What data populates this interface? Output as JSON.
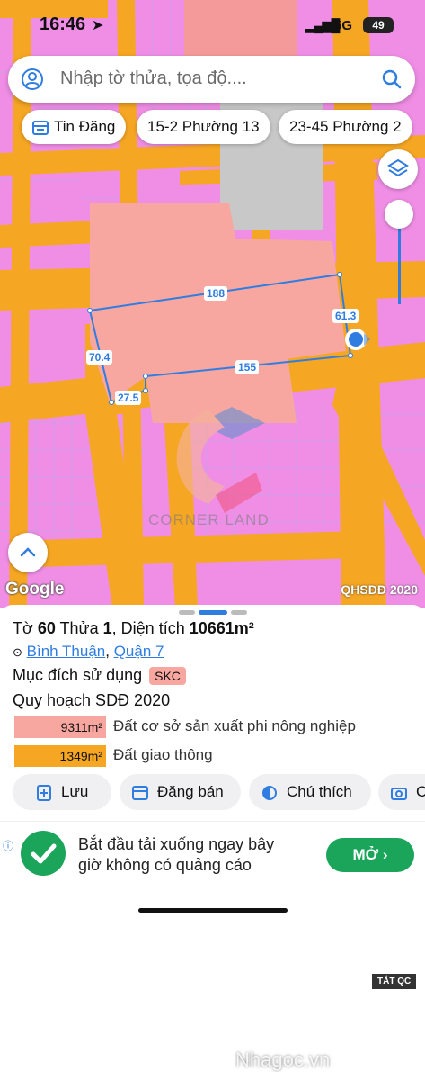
{
  "status": {
    "time": "16:46",
    "network": "5G",
    "battery": "49"
  },
  "search": {
    "placeholder": "Nhập tờ thửa, tọa độ...."
  },
  "chips": [
    "Tin Đăng",
    "15-2 Phường 13",
    "23-45 Phường 2"
  ],
  "map": {
    "edge_labels": [
      "188",
      "61.3",
      "70.4",
      "155",
      "27.5"
    ],
    "watermark": "CORNER LAND",
    "google": "Google",
    "layer_name": "QHSDĐ 2020"
  },
  "parcel": {
    "to_label": "Tờ",
    "to": "60",
    "thua_label": "Thửa",
    "thua": "1",
    "area_label": "Diện tích",
    "area": "10661m²",
    "province": "Bình Thuận",
    "district": "Quận 7",
    "purpose_label": "Mục đích sử dụng",
    "purpose_code": "SKC",
    "plan_label": "Quy hoạch SDĐ 2020",
    "land_uses": [
      {
        "area": "9311m²",
        "name": "Đất cơ sở sản xuất phi nông nghiệp",
        "color": "#f8a7a0"
      },
      {
        "area": "1349m²",
        "name": "Đất giao thông",
        "color": "#f5a623"
      }
    ]
  },
  "actions": [
    "Lưu",
    "Đăng bán",
    "Chú thích",
    "C"
  ],
  "ad": {
    "badge": "TẮT QC",
    "line1": "Bắt đầu tải xuống ngay bây",
    "line2": "giờ không có quảng cáo",
    "cta": "MỞ",
    "watermark": "Nhagoc.vn"
  },
  "colors": {
    "accent": "#2f7de1",
    "map_pink": "#f08ee6",
    "road": "#f5a623",
    "plot": "#f8a7a0",
    "ad_green": "#1aa55a"
  }
}
